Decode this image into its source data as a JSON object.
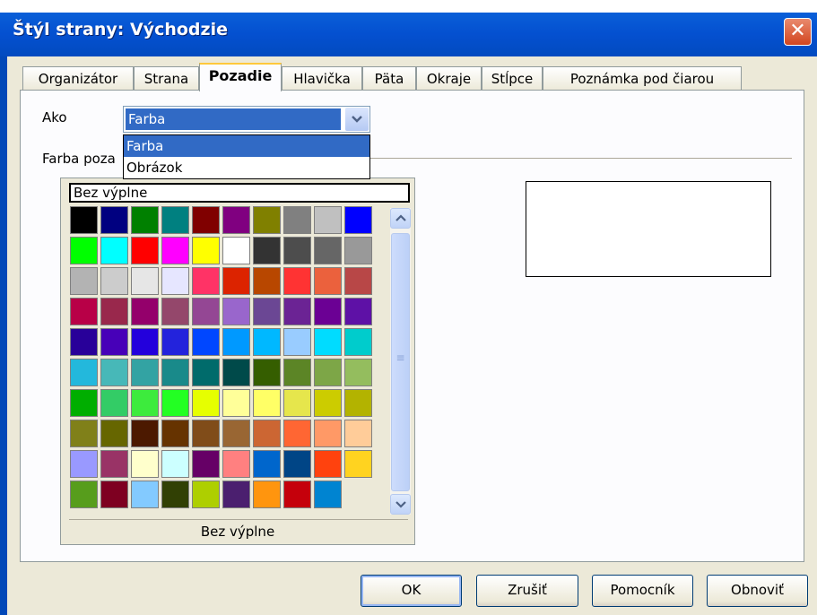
{
  "window": {
    "title": "Štýl strany: Východzie",
    "close_symbol": "✕"
  },
  "tabs": [
    {
      "label": "Organizátor",
      "active": false
    },
    {
      "label": "Strana",
      "active": false
    },
    {
      "label": "Pozadie",
      "active": true
    },
    {
      "label": "Hlavička",
      "active": false
    },
    {
      "label": "Päta",
      "active": false
    },
    {
      "label": "Okraje",
      "active": false
    },
    {
      "label": "Stĺpce",
      "active": false
    },
    {
      "label": "Poznámka pod čiarou",
      "active": false
    }
  ],
  "as_field": {
    "label": "Ako",
    "value": "Farba",
    "options": [
      "Farba",
      "Obrázok"
    ],
    "highlighted_option": "Farba"
  },
  "background_color": {
    "label": "Farba poza",
    "selected": "Bez výplne",
    "caption": "Bez výplne",
    "swatches": [
      "#000000",
      "#000080",
      "#008000",
      "#008080",
      "#800000",
      "#800080",
      "#808000",
      "#808080",
      "#c0c0c0",
      "#0000ff",
      "#00ff00",
      "#00ffff",
      "#ff0000",
      "#ff00ff",
      "#ffff00",
      "#ffffff",
      "#333333",
      "#4d4d4d",
      "#666666",
      "#999999",
      "#b3b3b3",
      "#cccccc",
      "#e6e6e6",
      "#e6e6ff",
      "#ff3366",
      "#dc2300",
      "#b84700",
      "#ff3333",
      "#eb613d",
      "#b84747",
      "#b80047",
      "#99284c",
      "#94006b",
      "#94476b",
      "#944794",
      "#9966cc",
      "#6b4794",
      "#6b2394",
      "#6b0094",
      "#5e11a6",
      "#280099",
      "#4700b8",
      "#2300dc",
      "#2323dc",
      "#0047ff",
      "#0099ff",
      "#00b8ff",
      "#99ccff",
      "#00dcff",
      "#00cccc",
      "#23b8dc",
      "#47b8b8",
      "#33a3a3",
      "#198a8a",
      "#006b6b",
      "#004a4a",
      "#355e00",
      "#5c8526",
      "#7da647",
      "#94bd5e",
      "#00ae00",
      "#33cc66",
      "#3deb3d",
      "#23ff23",
      "#e6ff00",
      "#ffff99",
      "#ffff66",
      "#e6e64c",
      "#cccc00",
      "#b3b300",
      "#808019",
      "#666600",
      "#4c1900",
      "#663300",
      "#804c19",
      "#996633",
      "#cc6633",
      "#ff6633",
      "#ff9966",
      "#ffcc99",
      "#9999ff",
      "#993366",
      "#ffffcc",
      "#ccffff",
      "#660066",
      "#ff8080",
      "#0066cc",
      "#004586",
      "#ff420e",
      "#ffd320",
      "#579d1c",
      "#7e0021",
      "#83caff",
      "#314004",
      "#aecf00",
      "#4b1f6f",
      "#ff950e",
      "#c5000b",
      "#0084d1"
    ]
  },
  "scrollbar": {
    "up": "▲",
    "down": "▼",
    "grip": "≡"
  },
  "buttons": {
    "ok": "OK",
    "cancel": "Zrušiť",
    "help": "Pomocník",
    "reset": "Obnoviť"
  }
}
